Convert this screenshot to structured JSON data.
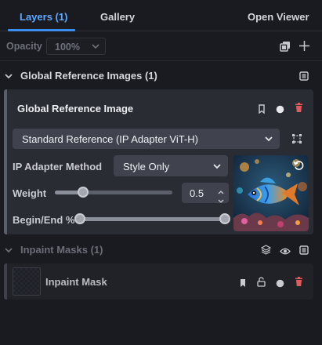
{
  "tabs": [
    {
      "label": "Layers (1)",
      "active": true
    },
    {
      "label": "Gallery",
      "active": false
    },
    {
      "label": "Open Viewer",
      "active": false
    }
  ],
  "opacity": {
    "label": "Opacity",
    "value": "100%"
  },
  "global_refs": {
    "header": "Global Reference Images (1)",
    "card": {
      "title": "Global Reference Image",
      "model_select": "Standard Reference (IP Adapter ViT-H)",
      "method_label": "IP Adapter Method",
      "method_value": "Style Only",
      "weight_label": "Weight",
      "weight_value": "0.5",
      "begin_end_label": "Begin/End %",
      "begin_end_range": [
        0,
        1
      ]
    }
  },
  "inpaint": {
    "header": "Inpaint Masks (1)",
    "mask_title": "Inpaint Mask"
  },
  "colors": {
    "accent": "#3b8df0",
    "delete": "#e05b5b",
    "background": "#1a1b21",
    "card": "#2a2c34"
  },
  "icons": [
    "chevron-down-icon",
    "duplicate-icon",
    "plus-icon",
    "bookmark-icon",
    "circle-icon",
    "trash-icon",
    "crop-icon",
    "reset-icon",
    "layers-icon",
    "eye-icon",
    "lock-icon",
    "menu-icon"
  ]
}
